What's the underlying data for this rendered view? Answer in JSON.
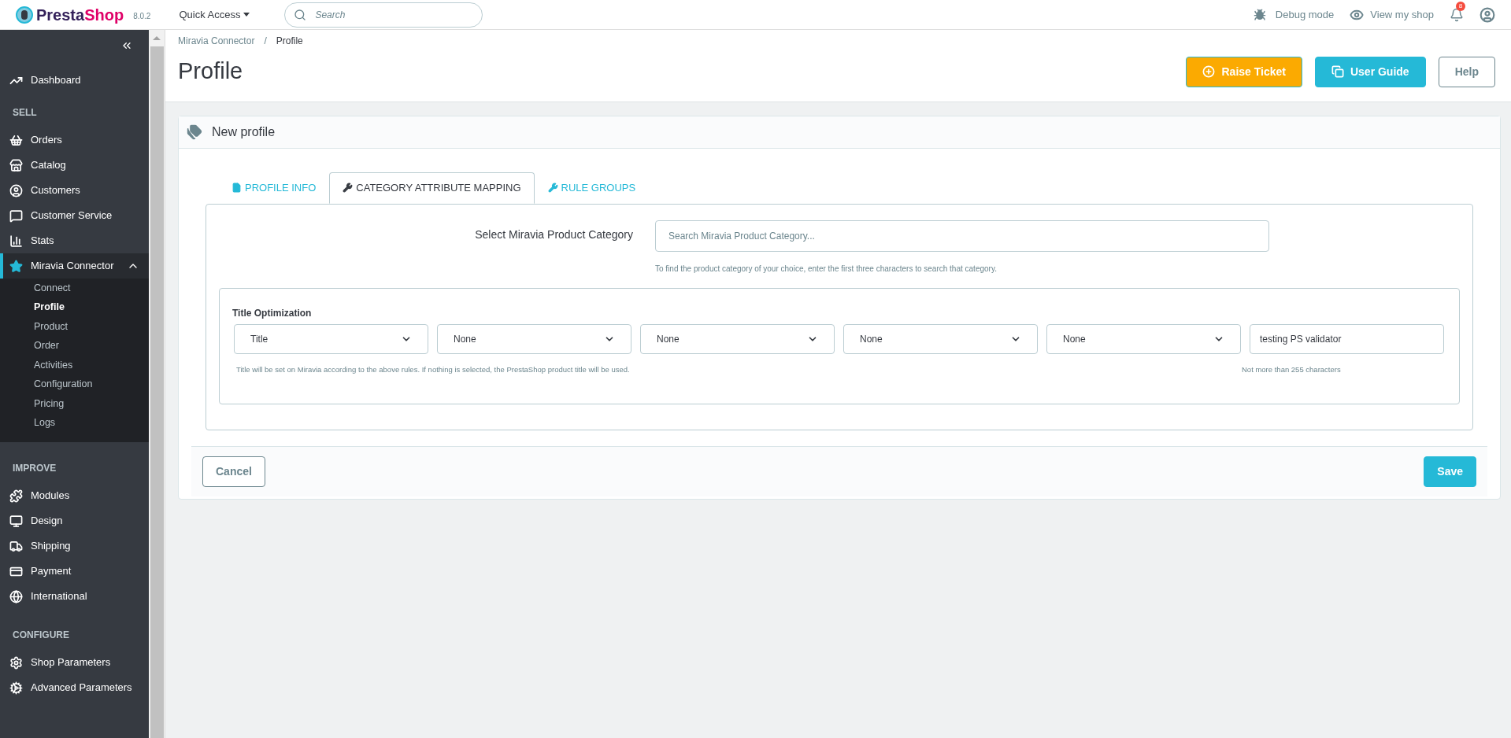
{
  "topbar": {
    "brand": [
      "Presta",
      "Shop"
    ],
    "version": "8.0.2",
    "quick_access": "Quick Access",
    "search": {
      "placeholder": "Search"
    },
    "debug_mode": "Debug mode",
    "view_shop": "View my shop",
    "notifications": "8"
  },
  "sidebar": {
    "items": [
      {
        "kind": "item",
        "label": "Dashboard",
        "selected": false
      },
      {
        "kind": "heading",
        "label": "SELL"
      },
      {
        "kind": "item",
        "label": "Orders",
        "selected": false
      },
      {
        "kind": "item",
        "label": "Catalog",
        "selected": false
      },
      {
        "kind": "item",
        "label": "Customers",
        "selected": false
      },
      {
        "kind": "item",
        "label": "Customer Service",
        "selected": false
      },
      {
        "kind": "item",
        "label": "Stats",
        "selected": false
      },
      {
        "kind": "item",
        "label": "Miravia Connector",
        "selected": true,
        "expanded": true,
        "children": [
          {
            "label": "Connect",
            "selected": false
          },
          {
            "label": "Profile",
            "selected": true
          },
          {
            "label": "Product",
            "selected": false
          },
          {
            "label": "Order",
            "selected": false
          },
          {
            "label": "Activities",
            "selected": false
          },
          {
            "label": "Configuration",
            "selected": false
          },
          {
            "label": "Pricing",
            "selected": false
          },
          {
            "label": "Logs",
            "selected": false
          }
        ]
      },
      {
        "kind": "heading",
        "label": "IMPROVE"
      },
      {
        "kind": "item",
        "label": "Modules",
        "selected": false
      },
      {
        "kind": "item",
        "label": "Design",
        "selected": false
      },
      {
        "kind": "item",
        "label": "Shipping",
        "selected": false
      },
      {
        "kind": "item",
        "label": "Payment",
        "selected": false
      },
      {
        "kind": "item",
        "label": "International",
        "selected": false
      },
      {
        "kind": "heading",
        "label": "CONFIGURE"
      },
      {
        "kind": "item",
        "label": "Shop Parameters",
        "selected": false
      },
      {
        "kind": "item",
        "label": "Advanced Parameters",
        "selected": false
      }
    ]
  },
  "breadcrumb": [
    "Miravia Connector",
    "/",
    "Profile"
  ],
  "page_title": "Profile",
  "header_buttons": [
    {
      "kind": "warning",
      "label": "Raise Ticket"
    },
    {
      "kind": "info",
      "label": "User Guide"
    },
    {
      "kind": "outline",
      "label": "Help"
    }
  ],
  "card": {
    "title": "New profile",
    "tabs": [
      {
        "label": "PROFILE INFO",
        "selected": false
      },
      {
        "label": "CATEGORY ATTRIBUTE MAPPING",
        "selected": true
      },
      {
        "label": "RULE GROUPS",
        "selected": false
      }
    ],
    "category": {
      "label": "Select Miravia Product Category",
      "placeholder": "Search Miravia Product Category...",
      "hint": "To find the product category of your choice, enter the first three characters to search that category."
    },
    "title_optimization": {
      "label": "Title Optimization",
      "selects": [
        "Title",
        "None",
        "None",
        "None",
        "None"
      ],
      "custom_text": "testing PS validator",
      "hint": "Title will be set on Miravia according to the above rules. If nothing is selected, the PrestaShop product title will be used.",
      "custom_hint": "Not more than 255 characters"
    },
    "footer_buttons": [
      {
        "kind": "outline",
        "label": "Cancel"
      },
      {
        "kind": "primary",
        "label": "Save"
      }
    ]
  }
}
